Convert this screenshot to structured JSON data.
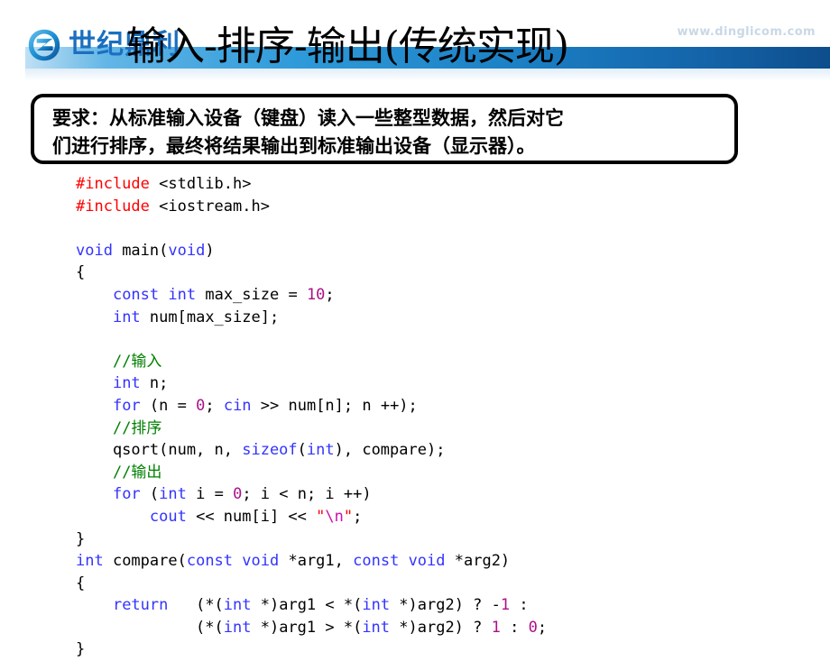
{
  "header": {
    "logo_text": "世纪鼎利",
    "logo_icon": "dingli-swirl-logo-icon",
    "watermark": "www.dinglicom.com",
    "title": "输入-排序-输出(传统实现)",
    "band_color_left": "#63b6e6",
    "band_color_right": "#0d4d8c",
    "logo_color": "#1b6fc0"
  },
  "requirement": {
    "line1": "要求：从标准输入设备（键盘）读入一些整型数据，然后对它",
    "line2": "们进行排序，最终将结果输出到标准输出设备（显示器）。"
  },
  "code": {
    "colors": {
      "keyword": "#3333ff",
      "preprocessor": "#ff0000",
      "number": "#aa1188",
      "comment": "#008000",
      "string": "#ff0000",
      "plain": "#000000"
    },
    "lines": [
      "#include <stdlib.h>",
      "#include <iostream.h>",
      "",
      "void main(void)",
      "{",
      "    const int max_size = 10;",
      "    int num[max_size];",
      "",
      "    //输入",
      "    int n;",
      "    for (n = 0; cin >> num[n]; n ++);",
      "    //排序",
      "    qsort(num, n, sizeof(int), compare);",
      "    //输出",
      "    for (int i = 0; i < n; i ++)",
      "        cout << num[i] << \"\\n\";",
      "}",
      "int compare(const void *arg1, const void *arg2)",
      "{",
      "    return   (*(int *)arg1 < *(int *)arg2) ? -1 :",
      "             (*(int *)arg1 > *(int *)arg2) ? 1 : 0;",
      "}"
    ]
  }
}
